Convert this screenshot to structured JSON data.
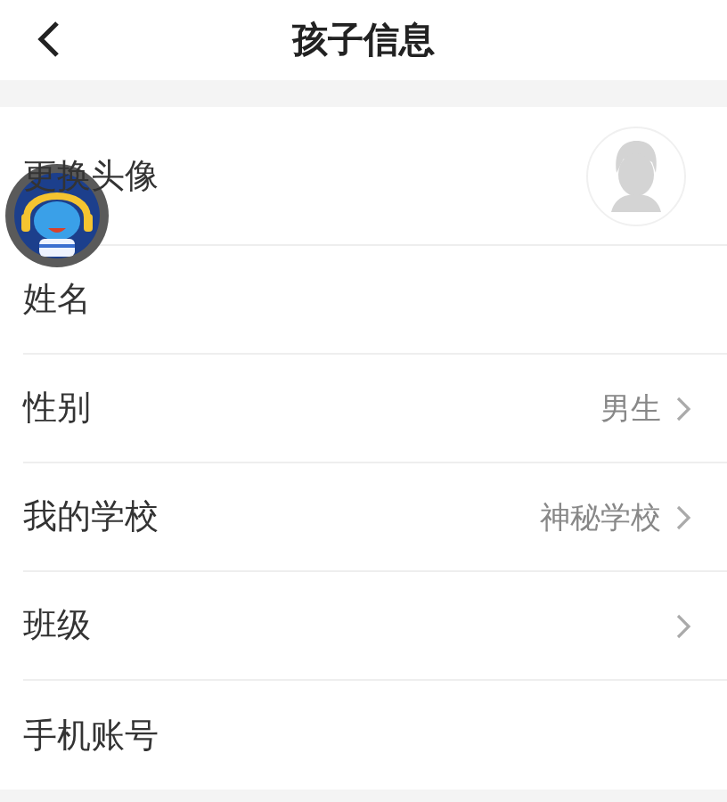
{
  "header": {
    "title": "孩子信息"
  },
  "rows": [
    {
      "kind": "avatar",
      "label": "更换头像"
    },
    {
      "kind": "text",
      "label": "姓名",
      "chevron": false
    },
    {
      "kind": "text",
      "label": "性别",
      "value": "男生",
      "chevron": true
    },
    {
      "kind": "text",
      "label": "我的学校",
      "value": "神秘学校",
      "chevron": true
    },
    {
      "kind": "text",
      "label": "班级",
      "chevron": true
    },
    {
      "kind": "text",
      "label": "手机账号",
      "chevron": false
    }
  ]
}
